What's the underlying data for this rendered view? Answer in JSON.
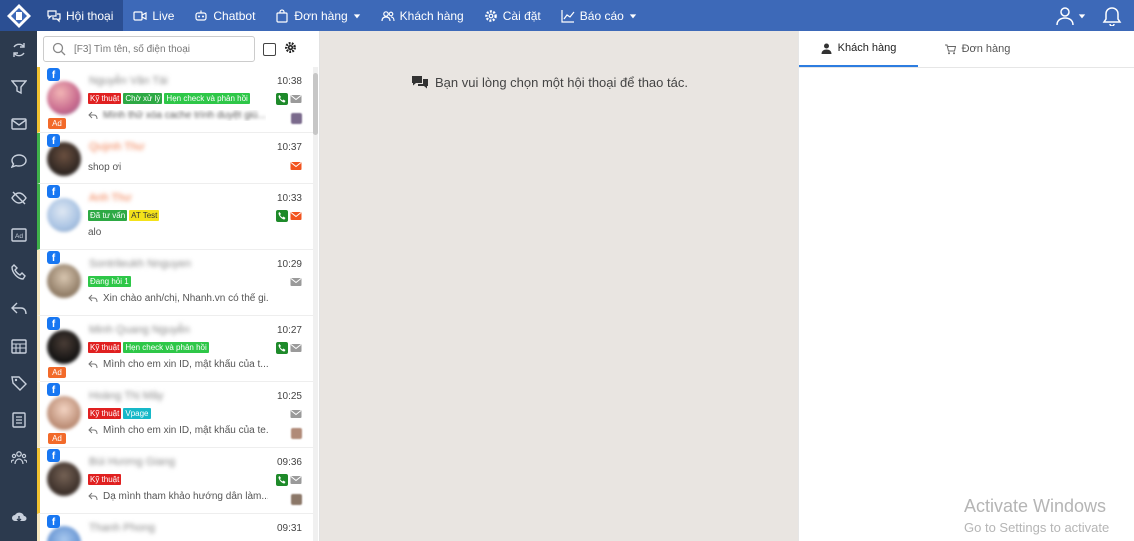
{
  "nav": {
    "items": [
      {
        "label": "Hội thoại",
        "icon": "chat-icon",
        "active": true
      },
      {
        "label": "Live",
        "icon": "video-icon",
        "active": false
      },
      {
        "label": "Chatbot",
        "icon": "bot-icon",
        "active": false
      },
      {
        "label": "Đơn hàng",
        "icon": "bag-icon",
        "active": false,
        "dropdown": true
      },
      {
        "label": "Khách hàng",
        "icon": "users-icon",
        "active": false
      },
      {
        "label": "Cài đặt",
        "icon": "gear-icon",
        "active": false
      },
      {
        "label": "Báo cáo",
        "icon": "chart-icon",
        "active": false,
        "dropdown": true
      }
    ]
  },
  "sidebar": {
    "icons": [
      "refresh-icon",
      "filter-icon",
      "mail-icon",
      "comment-icon",
      "hidden-icon",
      "ad-icon",
      "phone-icon",
      "reply-icon",
      "calendar-icon",
      "tag-icon",
      "list-icon",
      "group-icon"
    ],
    "bottom_icon": "cloud-download-icon"
  },
  "search": {
    "placeholder": "[F3] Tìm tên, số điện thoại"
  },
  "conversations": [
    {
      "name": "Nguyễn Văn Tài",
      "time": "10:38",
      "ad": true,
      "tags": [
        {
          "label": "Kỹ thuật",
          "color": "#e02020"
        },
        {
          "label": "Chờ xử lý",
          "color": "#2da944"
        },
        {
          "label": "Hẹn check và phản hồi",
          "color": "#2ec748"
        }
      ],
      "message": "Mình thử xóa cache trình duyệt giú...",
      "message_blurred": true,
      "reply": true,
      "phone": true,
      "mail": "grey",
      "thumb": true
    },
    {
      "name": "Quỳnh Thư",
      "time": "10:37",
      "ad": false,
      "tags": [],
      "message": "shop ơi",
      "reply": false,
      "phone": false,
      "mail": "orange",
      "thumb": false
    },
    {
      "name": "Anh Thư",
      "time": "10:33",
      "ad": false,
      "tags": [
        {
          "label": "Đã tư vấn",
          "color": "#2da944"
        },
        {
          "label": "AT Test",
          "color": "#f4e21a",
          "text": "#333"
        }
      ],
      "message": "alo",
      "reply": false,
      "phone": true,
      "mail": "orange",
      "thumb": false
    },
    {
      "name": "Sontrileukh Nnguyen",
      "time": "10:29",
      "ad": false,
      "tags": [
        {
          "label": "Đang hỏi 1",
          "color": "#2ec748"
        }
      ],
      "message": "Xin chào anh/chị, Nhanh.vn có thể gi...",
      "reply": true,
      "phone": false,
      "mail": "grey",
      "thumb": false
    },
    {
      "name": "Minh Quang Nguyễn",
      "time": "10:27",
      "ad": true,
      "tags": [
        {
          "label": "Kỹ thuật",
          "color": "#e02020"
        },
        {
          "label": "Hẹn check và phản hồi",
          "color": "#2ec748"
        }
      ],
      "message": "Mình cho em xin ID, mật khẩu của t...",
      "reply": true,
      "phone": true,
      "mail": "grey",
      "thumb": false
    },
    {
      "name": "Hoàng Thị Mây",
      "time": "10:25",
      "ad": true,
      "tags": [
        {
          "label": "Kỹ thuật",
          "color": "#e02020"
        },
        {
          "label": "Vpage",
          "color": "#17b8c8"
        }
      ],
      "message": "Mình cho em xin ID, mật khẩu của te...",
      "reply": true,
      "phone": false,
      "mail": "grey",
      "thumb": true
    },
    {
      "name": "Bùi Hương Giang",
      "time": "09:36",
      "ad": false,
      "tags": [
        {
          "label": "Kỹ thuật",
          "color": "#e02020"
        }
      ],
      "message": "Dạ mình tham khảo hướng dẫn làm...",
      "reply": true,
      "phone": true,
      "mail": "grey",
      "thumb": true
    },
    {
      "name": "Thanh Phong",
      "time": "09:31",
      "ad": false,
      "tags": [],
      "message": "",
      "reply": false,
      "phone": false,
      "mail": "none",
      "thumb": false
    }
  ],
  "center": {
    "hint": "Bạn vui lòng chọn một hội thoại để thao tác."
  },
  "right_tabs": [
    {
      "label": "Khách hàng",
      "icon": "user-icon",
      "active": true
    },
    {
      "label": "Đơn hàng",
      "icon": "cart-icon",
      "active": false
    }
  ],
  "watermark": {
    "line1": "Activate Windows",
    "line2": "Go to Settings to activate"
  },
  "colors": {
    "topbar": "#3d69b8",
    "sidebar": "#2c3a4e",
    "center_bg": "#e9e5e1",
    "accent_tab": "#2d7de0"
  }
}
